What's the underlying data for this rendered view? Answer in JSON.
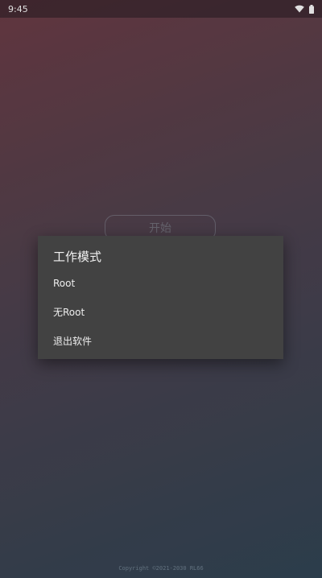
{
  "status_bar": {
    "time": "9:45",
    "icons": [
      "wifi-icon",
      "battery-icon"
    ]
  },
  "main": {
    "start_label": "开始"
  },
  "dialog": {
    "title": "工作模式",
    "options": [
      {
        "label": "Root"
      },
      {
        "label": "无Root"
      },
      {
        "label": "退出软件"
      }
    ]
  },
  "footer": {
    "copyright": "Copyright ©2021-2030 RL66"
  },
  "colors": {
    "dialog_bg": "#424242",
    "gradient_top": "#6e3d47",
    "gradient_bottom": "#324656"
  }
}
